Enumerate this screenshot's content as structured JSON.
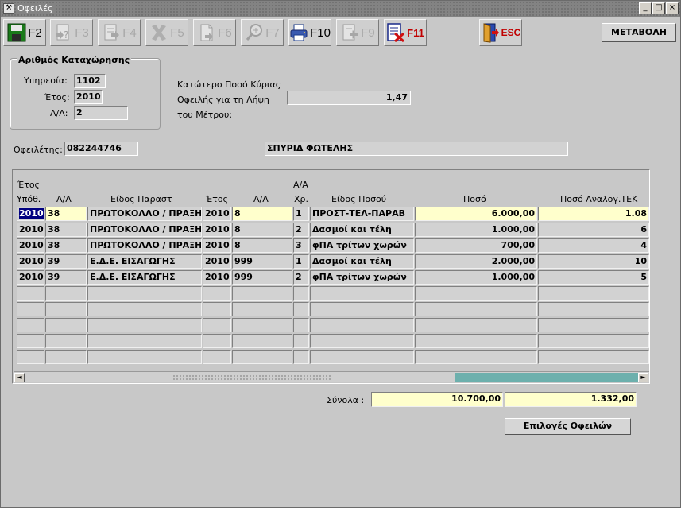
{
  "window": {
    "title": "Οφειλές",
    "minimize_glyph": "_",
    "maximize_glyph": "□",
    "close_glyph": "×"
  },
  "toolbar": {
    "buttons": [
      {
        "label": "F2",
        "icon": "save-icon",
        "enabled": true
      },
      {
        "label": "F3",
        "icon": "query-icon",
        "enabled": false
      },
      {
        "label": "F4",
        "icon": "execute-icon",
        "enabled": false
      },
      {
        "label": "F5",
        "icon": "delete-icon",
        "enabled": false
      },
      {
        "label": "F6",
        "icon": "new-icon",
        "enabled": false
      },
      {
        "label": "F7",
        "icon": "search-icon",
        "enabled": false
      },
      {
        "label": "F10",
        "icon": "print-icon",
        "enabled": true
      },
      {
        "label": "F9",
        "icon": "add-icon",
        "enabled": false
      },
      {
        "label": "F11",
        "icon": "cancel-doc-icon",
        "enabled": true
      },
      {
        "label": "ESC",
        "icon": "exit-door-icon",
        "enabled": true
      }
    ],
    "metavoli_label": "ΜΕΤΑΒΟΛΗ"
  },
  "registration": {
    "legend": "Αριθμός Καταχώρησης",
    "service_label": "Υπηρεσία:",
    "service_value": "1102",
    "year_label": "Έτος:",
    "year_value": "2010",
    "aa_label": "Α/Α:",
    "aa_value": "2"
  },
  "threshold": {
    "label_line1": "Κατώτερο Ποσό Κύριας",
    "label_line2": "Οφειλής για τη Λήψη",
    "label_line3": "του Μέτρου:",
    "value": "1,47"
  },
  "debtor": {
    "label": "Οφειλέτης:",
    "afm": "082244746",
    "name": "ΣΠΥΡΙΔ ΦΩΤΕΛΗΣ"
  },
  "grid": {
    "header_top": {
      "etos": "Έτος",
      "aa_xr": "Α/Α"
    },
    "headers": [
      "Υπόθ.",
      "Α/Α",
      "Είδος Παραστ",
      "Έτος",
      "Α/Α",
      "Χρ.",
      "Είδος Ποσού",
      "Ποσό",
      "Ποσό Αναλογ.ΤΕΚ"
    ],
    "rows": [
      [
        "2010",
        "38",
        "ΠΡΩΤΟΚΟΛΛΟ / ΠΡΑΞΗ",
        "2010",
        "8",
        "1",
        "ΠΡΟΣΤ-ΤΕΛ-ΠΑΡΑΒ",
        "6.000,00",
        "1.08"
      ],
      [
        "2010",
        "38",
        "ΠΡΩΤΟΚΟΛΛΟ / ΠΡΑΞΗ",
        "2010",
        "8",
        "2",
        "Δασμοί και τέλη",
        "1.000,00",
        "6"
      ],
      [
        "2010",
        "38",
        "ΠΡΩΤΟΚΟΛΛΟ / ΠΡΑΞΗ",
        "2010",
        "8",
        "3",
        "φΠΑ τρίτων χωρών",
        "700,00",
        "4"
      ],
      [
        "2010",
        "39",
        "Ε.Δ.Ε. ΕΙΣΑΓΩΓΗΣ",
        "2010",
        "999",
        "1",
        "Δασμοί και τέλη",
        "2.000,00",
        "10"
      ],
      [
        "2010",
        "39",
        "Ε.Δ.Ε. ΕΙΣΑΓΩΓΗΣ",
        "2010",
        "999",
        "2",
        "φΠΑ τρίτων χωρών",
        "1.000,00",
        "5"
      ],
      [
        "",
        "",
        "",
        "",
        "",
        "",
        "",
        "",
        ""
      ],
      [
        "",
        "",
        "",
        "",
        "",
        "",
        "",
        "",
        ""
      ],
      [
        "",
        "",
        "",
        "",
        "",
        "",
        "",
        "",
        ""
      ],
      [
        "",
        "",
        "",
        "",
        "",
        "",
        "",
        "",
        ""
      ],
      [
        "",
        "",
        "",
        "",
        "",
        "",
        "",
        "",
        ""
      ]
    ],
    "scroll_left": "◄",
    "scroll_right": "►"
  },
  "totals": {
    "label": "Σύνολα :",
    "amount": "10.700,00",
    "tek": "1.332,00"
  },
  "options_button": "Επιλογές Οφειλών"
}
